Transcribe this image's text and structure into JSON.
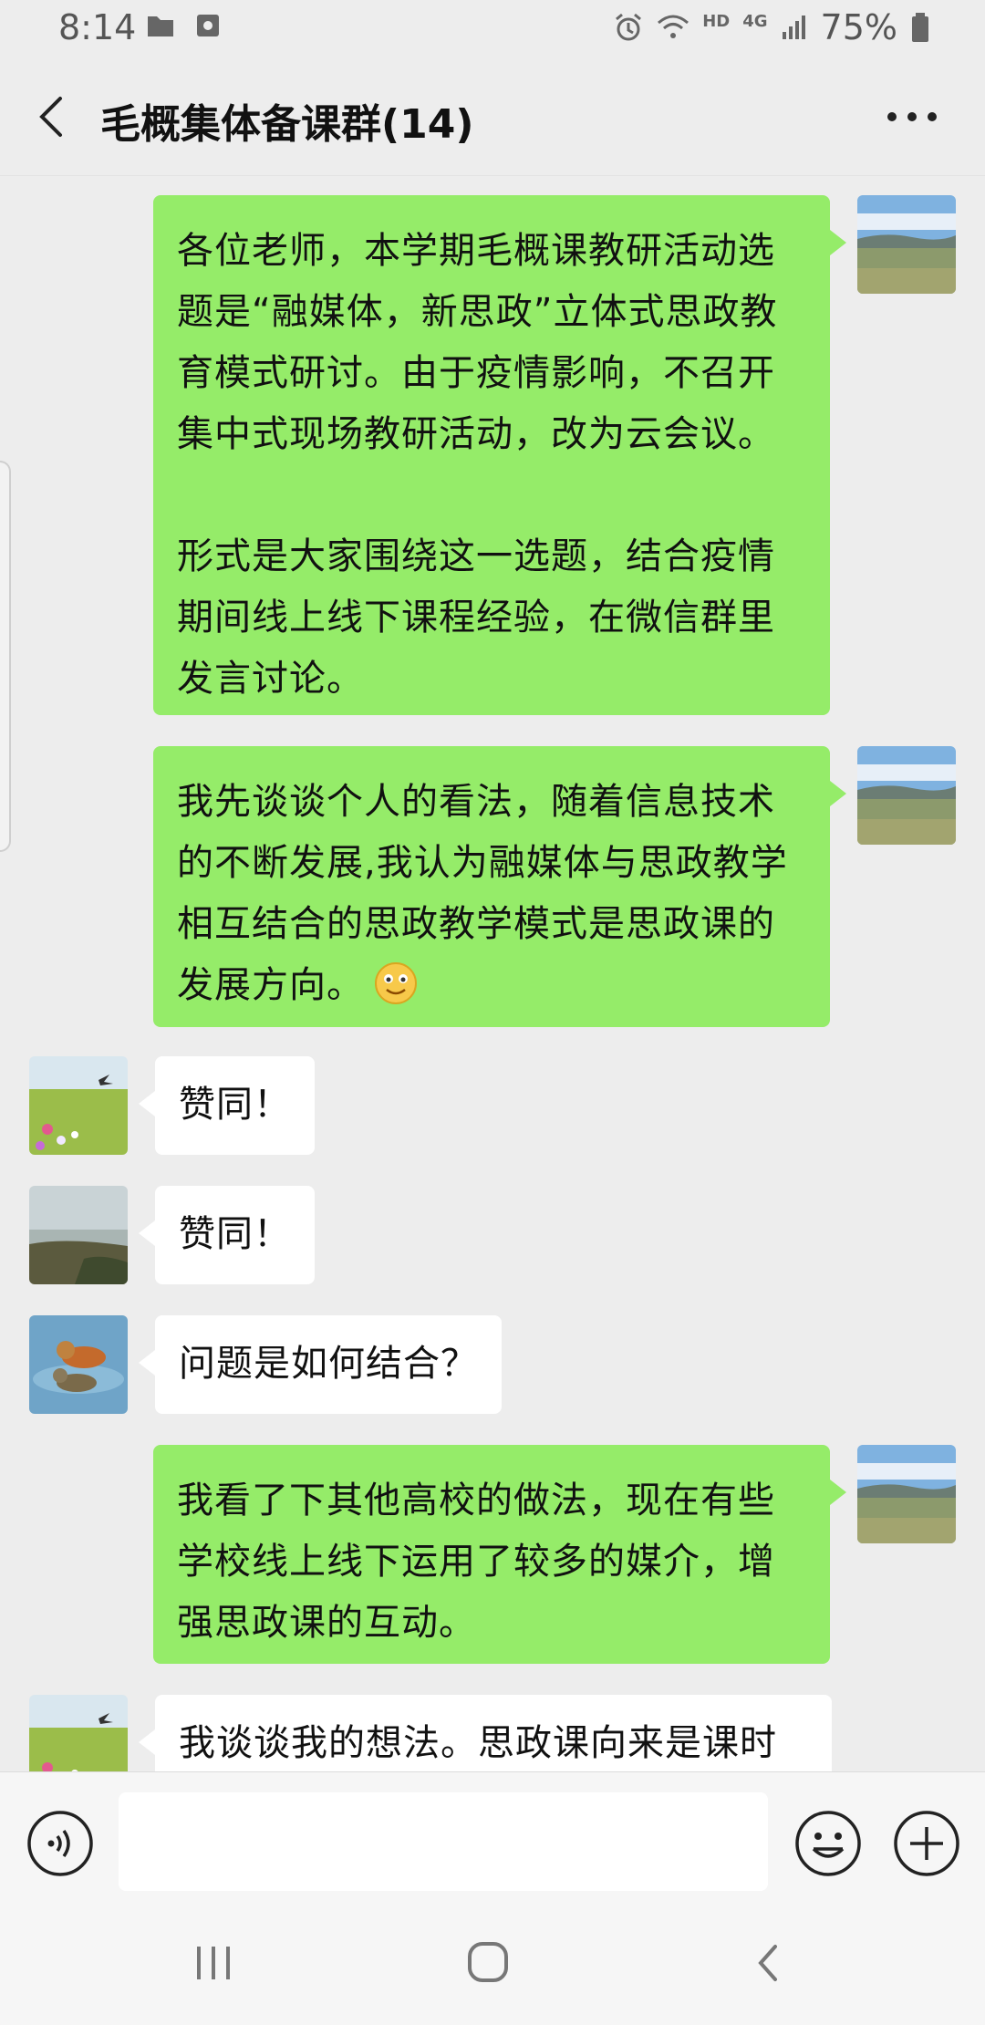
{
  "status_bar": {
    "time": "8:14",
    "network": "HD",
    "network_gen": "4G",
    "battery": "75%"
  },
  "header": {
    "title": "毛概集体备课群(14)"
  },
  "messages": [
    {
      "side": "right",
      "text": "各位老师，本学期毛概课教研活动选题是“融媒体，新思政”立体式思政教育模式研讨。由于疫情影响，不召开集中式现场教研活动，改为云会议。\n\n形式是大家围绕这一选题，结合疫情期间线上线下课程经验，在微信群里发言讨论。"
    },
    {
      "side": "right",
      "text": "我先谈谈个人的看法，随着信息技术的不断发展,我认为融媒体与思政教学相互结合的思政教学模式是思政课的发展方向。",
      "emoji": "smile-emoji"
    },
    {
      "side": "left",
      "text": "赞同！"
    },
    {
      "side": "left",
      "text": "赞同！"
    },
    {
      "side": "left",
      "text": "问题是如何结合？"
    },
    {
      "side": "right",
      "text": "我看了下其他高校的做法，现在有些学校线上线下运用了较多的媒介，增强思政课的互动。"
    },
    {
      "side": "left",
      "text": "我谈谈我的想法。思政课向来是课时"
    }
  ],
  "input": {
    "placeholder": ""
  },
  "colors": {
    "self_bubble": "#95ec69",
    "other_bubble": "#ffffff",
    "background": "#ededed"
  }
}
